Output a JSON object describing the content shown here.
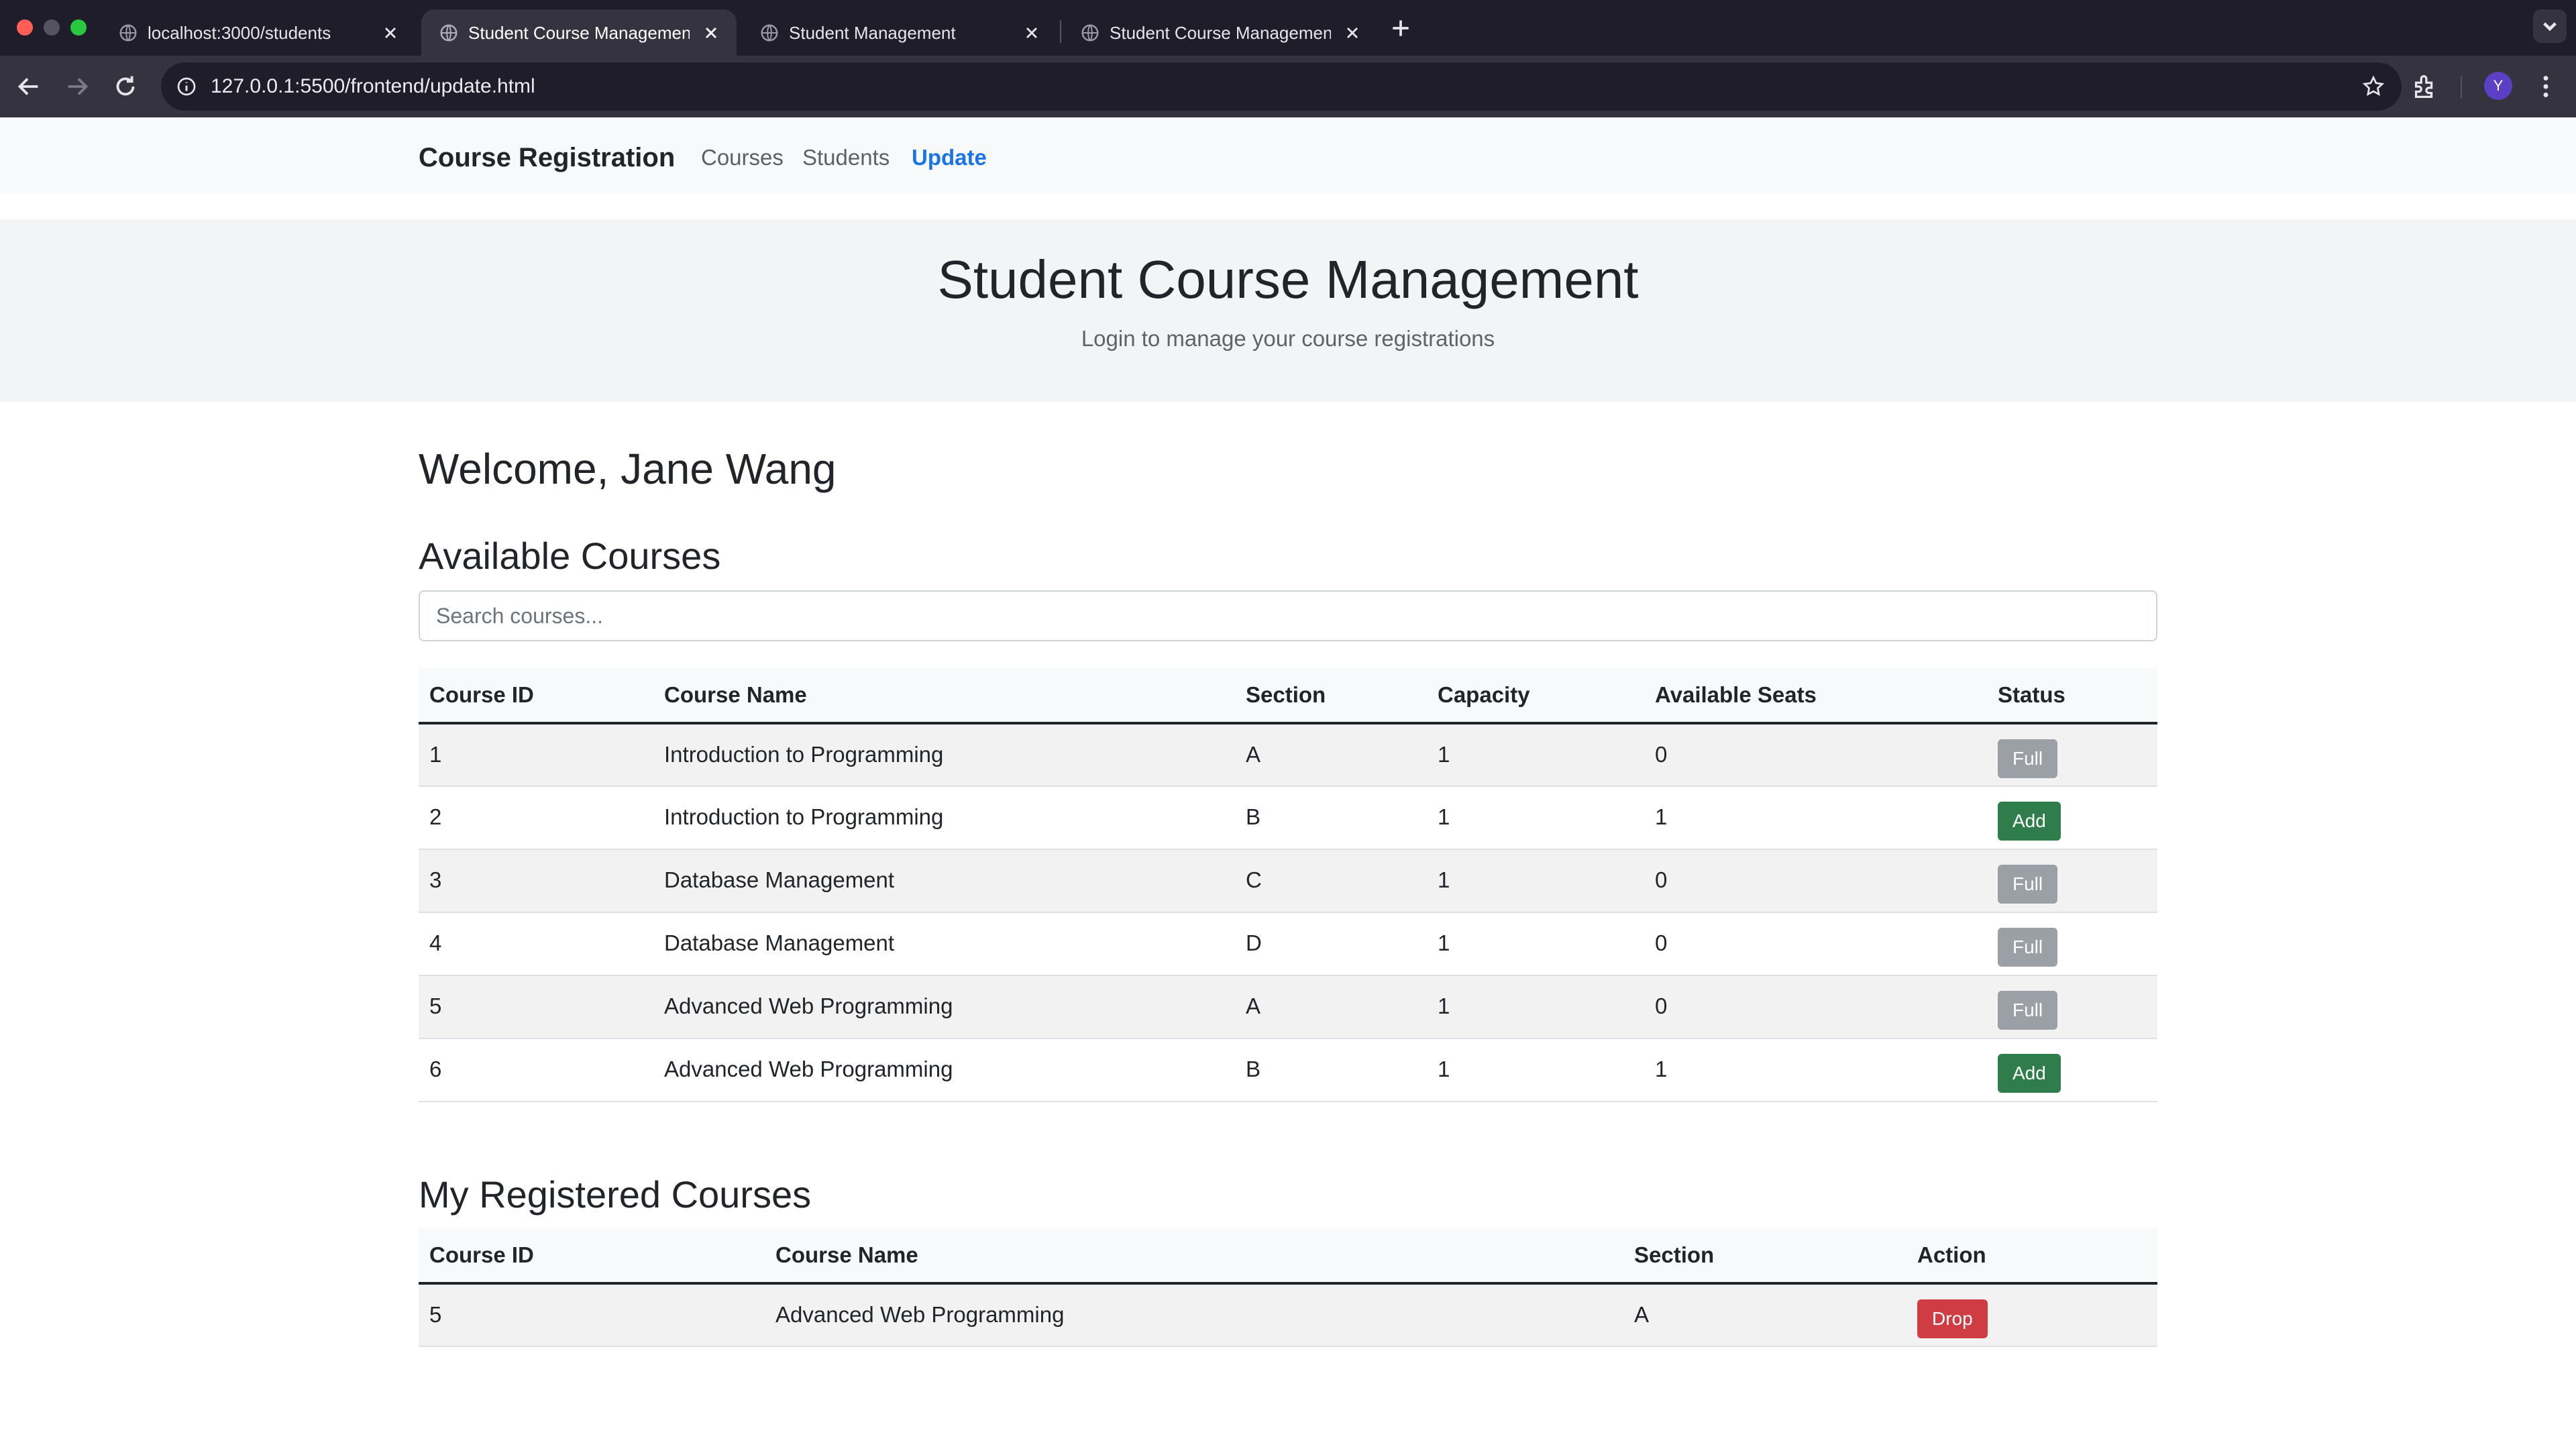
{
  "browser": {
    "tabs": [
      {
        "title": "localhost:3000/students",
        "active": false
      },
      {
        "title": "Student Course Management",
        "active": true
      },
      {
        "title": "Student Management",
        "active": false
      },
      {
        "title": "Student Course Management",
        "active": false
      }
    ],
    "url": "127.0.0.1:5500/frontend/update.html",
    "profile_initial": "Y"
  },
  "nav": {
    "brand": "Course Registration",
    "links": [
      {
        "label": "Courses",
        "active": false
      },
      {
        "label": "Students",
        "active": false
      },
      {
        "label": "Update",
        "active": true
      }
    ]
  },
  "hero": {
    "title": "Student Course Management",
    "subtitle": "Login to manage your course registrations"
  },
  "welcome": "Welcome, Jane Wang",
  "available": {
    "heading": "Available Courses",
    "search_placeholder": "Search courses...",
    "headers": [
      "Course ID",
      "Course Name",
      "Section",
      "Capacity",
      "Available Seats",
      "Status"
    ],
    "rows": [
      {
        "id": "1",
        "name": "Introduction to Programming",
        "section": "A",
        "capacity": "1",
        "seats": "0",
        "status": "Full"
      },
      {
        "id": "2",
        "name": "Introduction to Programming",
        "section": "B",
        "capacity": "1",
        "seats": "1",
        "status": "Add"
      },
      {
        "id": "3",
        "name": "Database Management",
        "section": "C",
        "capacity": "1",
        "seats": "0",
        "status": "Full"
      },
      {
        "id": "4",
        "name": "Database Management",
        "section": "D",
        "capacity": "1",
        "seats": "0",
        "status": "Full"
      },
      {
        "id": "5",
        "name": "Advanced Web Programming",
        "section": "A",
        "capacity": "1",
        "seats": "0",
        "status": "Full"
      },
      {
        "id": "6",
        "name": "Advanced Web Programming",
        "section": "B",
        "capacity": "1",
        "seats": "1",
        "status": "Add"
      }
    ]
  },
  "registered": {
    "heading": "My Registered Courses",
    "headers": [
      "Course ID",
      "Course Name",
      "Section",
      "Action"
    ],
    "rows": [
      {
        "id": "5",
        "name": "Advanced Web Programming",
        "section": "A",
        "action": "Drop"
      }
    ]
  },
  "colors": {
    "accent": "#1a73e8",
    "add_button": "#2e7d4a",
    "full_button": "#9aa0a6",
    "drop_button": "#d03c44"
  }
}
